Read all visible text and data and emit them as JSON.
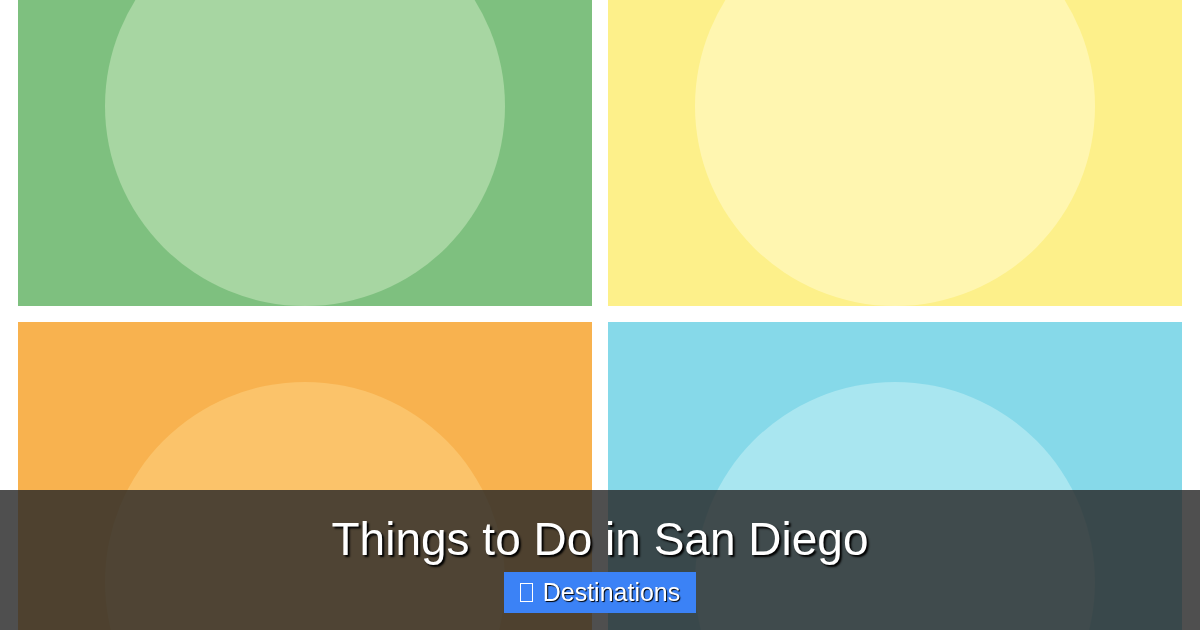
{
  "title": "Things to Do in San Diego",
  "category": {
    "label": "Destinations"
  }
}
